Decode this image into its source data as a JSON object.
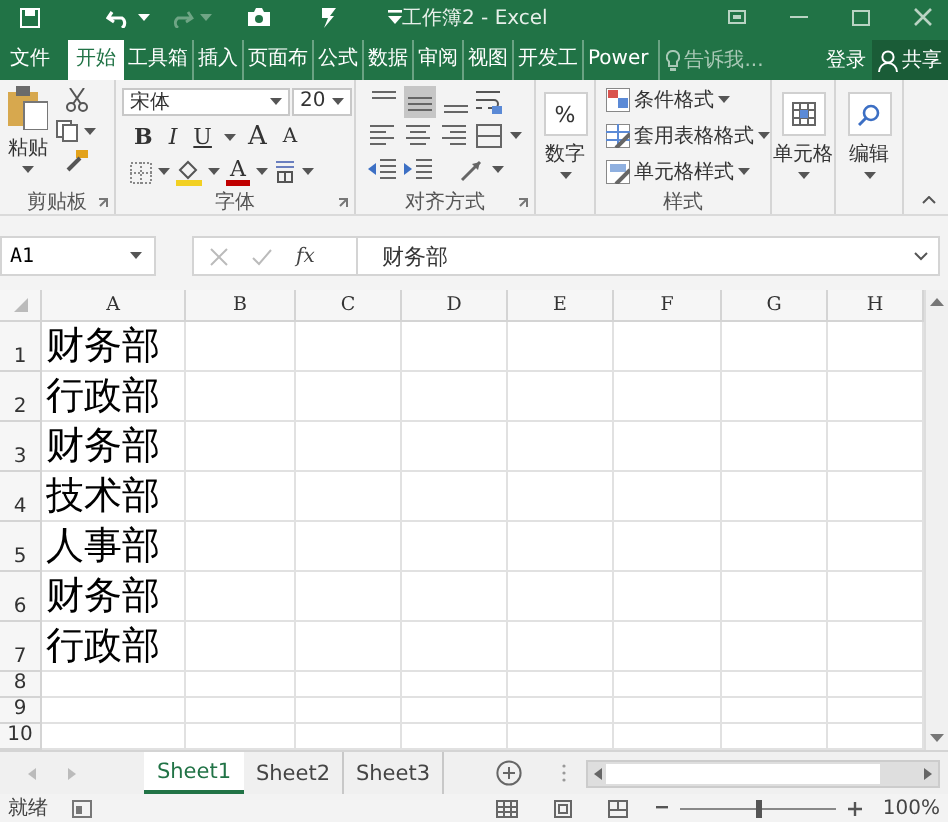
{
  "window": {
    "title": "工作簿2 - Excel"
  },
  "ribbon_tabs": [
    {
      "label": "文件",
      "selected": false
    },
    {
      "label": "开始",
      "selected": true
    },
    {
      "label": "工具箱",
      "selected": false
    },
    {
      "label": "插入",
      "selected": false
    },
    {
      "label": "页面布",
      "selected": false
    },
    {
      "label": "公式",
      "selected": false
    },
    {
      "label": "数据",
      "selected": false
    },
    {
      "label": "审阅",
      "selected": false
    },
    {
      "label": "视图",
      "selected": false
    },
    {
      "label": "开发工",
      "selected": false
    },
    {
      "label": "Power",
      "selected": false
    }
  ],
  "tell_me": {
    "placeholder": "告诉我..."
  },
  "account": {
    "sign_in": "登录",
    "share": "共享"
  },
  "clipboard": {
    "paste": "粘贴",
    "label": "剪贴板"
  },
  "font": {
    "name": "宋体",
    "size": "20",
    "label": "字体",
    "buttons": [
      {
        "kind": "bold",
        "label": "B"
      },
      {
        "kind": "italic",
        "label": "I"
      },
      {
        "kind": "underline",
        "label": "U"
      },
      {
        "kind": "grow",
        "label": "A"
      },
      {
        "kind": "shrink",
        "label": "A"
      }
    ],
    "font_color": "A"
  },
  "alignment": {
    "label": "对齐方式",
    "vertical": [
      {
        "kind": "top",
        "selected": false
      },
      {
        "kind": "middle",
        "selected": true
      },
      {
        "kind": "bottom",
        "selected": false
      }
    ]
  },
  "number": {
    "symbol": "%",
    "label": "数字"
  },
  "styles": {
    "items": [
      "条件格式",
      "套用表格格式",
      "单元格样式"
    ],
    "label": "样式"
  },
  "cells": {
    "label": "单元格"
  },
  "editing": {
    "label": "编辑"
  },
  "formula_bar": {
    "name_box": "A1",
    "insert_function": "fx",
    "value": "财务部"
  },
  "grid": {
    "columns": [
      "A",
      "B",
      "C",
      "D",
      "E",
      "F",
      "G",
      "H"
    ],
    "rows": [
      {
        "header": "1",
        "cells": [
          "财务部"
        ]
      },
      {
        "header": "2",
        "cells": [
          "行政部"
        ]
      },
      {
        "header": "3",
        "cells": [
          "财务部"
        ]
      },
      {
        "header": "4",
        "cells": [
          "技术部"
        ]
      },
      {
        "header": "5",
        "cells": [
          "人事部"
        ]
      },
      {
        "header": "6",
        "cells": [
          "财务部"
        ]
      },
      {
        "header": "7",
        "cells": [
          "行政部"
        ]
      },
      {
        "header": "8"
      },
      {
        "header": "9"
      },
      {
        "header": "10"
      }
    ]
  },
  "sheet_tabs": [
    {
      "label": "Sheet1",
      "selected": true
    },
    {
      "label": "Sheet2",
      "selected": false
    },
    {
      "label": "Sheet3",
      "selected": false
    }
  ],
  "status_bar": {
    "text": "就绪",
    "zoom": "100%",
    "zoom_slider": {
      "level": 0.5
    }
  }
}
